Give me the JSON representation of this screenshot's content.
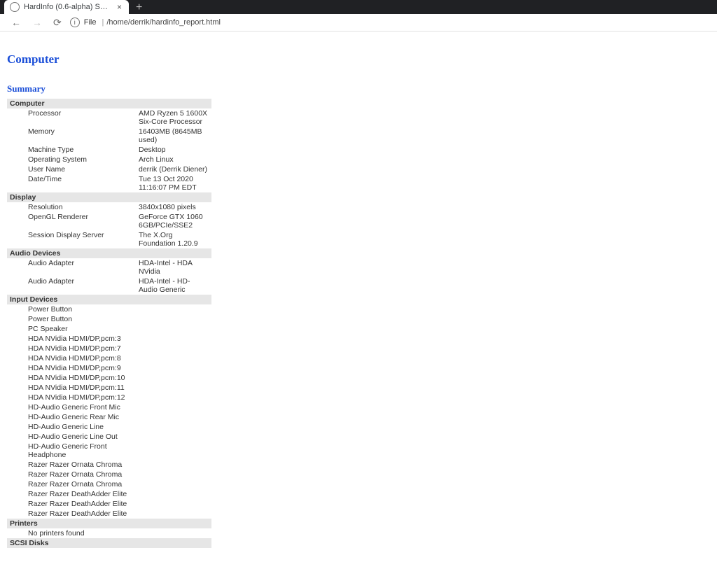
{
  "browser": {
    "tab_title": "HardInfo (0.6-alpha) Syste",
    "new_tab": "+",
    "close": "×",
    "back": "←",
    "forward": "→",
    "reload": "⟳",
    "info": "i",
    "file_label": "File",
    "path": "/home/derrik/hardinfo_report.html"
  },
  "page": {
    "h1": "Computer",
    "h2": "Summary",
    "sections": {
      "computer": {
        "title": "Computer",
        "rows": [
          {
            "k": "Processor",
            "v": "AMD Ryzen 5 1600X Six-Core Processor"
          },
          {
            "k": "Memory",
            "v": "16403MB (8645MB used)"
          },
          {
            "k": "Machine Type",
            "v": "Desktop"
          },
          {
            "k": "Operating System",
            "v": "Arch Linux"
          },
          {
            "k": "User Name",
            "v": "derrik (Derrik Diener)"
          },
          {
            "k": "Date/Time",
            "v": "Tue 13 Oct 2020 11:16:07 PM EDT"
          }
        ]
      },
      "display": {
        "title": "Display",
        "rows": [
          {
            "k": "Resolution",
            "v": "3840x1080 pixels"
          },
          {
            "k": "OpenGL Renderer",
            "v": "GeForce GTX 1060 6GB/PCIe/SSE2"
          },
          {
            "k": "Session Display Server",
            "v": "The X.Org Foundation 1.20.9"
          }
        ]
      },
      "audio": {
        "title": "Audio Devices",
        "rows": [
          {
            "k": "Audio Adapter",
            "v": "HDA-Intel - HDA NVidia"
          },
          {
            "k": "Audio Adapter",
            "v": "HDA-Intel - HD-Audio Generic"
          }
        ]
      },
      "input": {
        "title": "Input Devices",
        "rows": [
          {
            "k": "Power Button",
            "v": ""
          },
          {
            "k": "Power Button",
            "v": ""
          },
          {
            "k": "PC Speaker",
            "v": ""
          },
          {
            "k": "HDA NVidia HDMI/DP,pcm:3",
            "v": ""
          },
          {
            "k": "HDA NVidia HDMI/DP,pcm:7",
            "v": ""
          },
          {
            "k": "HDA NVidia HDMI/DP,pcm:8",
            "v": ""
          },
          {
            "k": "HDA NVidia HDMI/DP,pcm:9",
            "v": ""
          },
          {
            "k": "HDA NVidia HDMI/DP,pcm:10",
            "v": ""
          },
          {
            "k": "HDA NVidia HDMI/DP,pcm:11",
            "v": ""
          },
          {
            "k": "HDA NVidia HDMI/DP,pcm:12",
            "v": ""
          },
          {
            "k": "HD-Audio Generic Front Mic",
            "v": ""
          },
          {
            "k": "HD-Audio Generic Rear Mic",
            "v": ""
          },
          {
            "k": "HD-Audio Generic Line",
            "v": ""
          },
          {
            "k": "HD-Audio Generic Line Out",
            "v": ""
          },
          {
            "k": "HD-Audio Generic Front Headphone",
            "v": ""
          },
          {
            "k": "Razer Razer Ornata Chroma",
            "v": ""
          },
          {
            "k": "Razer Razer Ornata Chroma",
            "v": ""
          },
          {
            "k": "Razer Razer Ornata Chroma",
            "v": ""
          },
          {
            "k": "Razer Razer DeathAdder Elite",
            "v": ""
          },
          {
            "k": "Razer Razer DeathAdder Elite",
            "v": ""
          },
          {
            "k": "Razer Razer DeathAdder Elite",
            "v": ""
          }
        ]
      },
      "printers": {
        "title": "Printers",
        "rows": [
          {
            "k": "No printers found",
            "v": ""
          }
        ]
      },
      "scsi": {
        "title": "SCSI Disks",
        "rows": []
      }
    }
  }
}
